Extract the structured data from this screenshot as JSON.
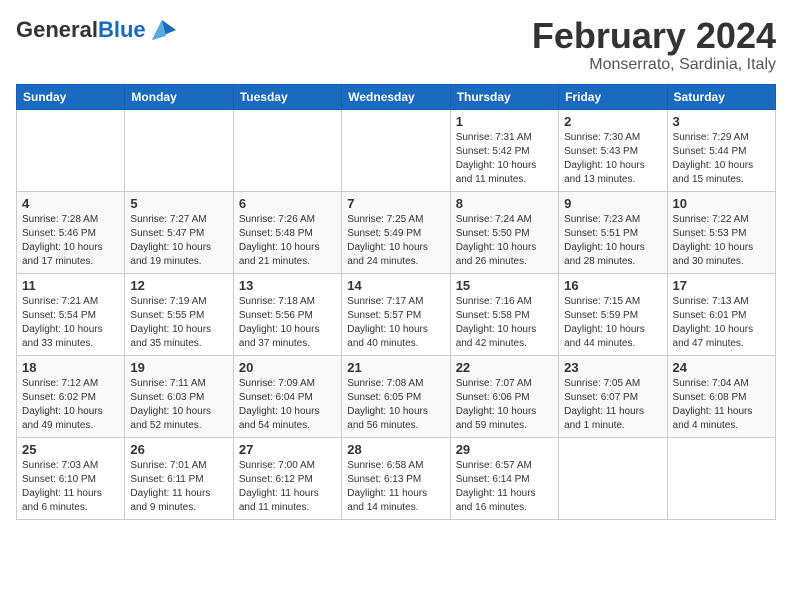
{
  "header": {
    "logo_general": "General",
    "logo_blue": "Blue",
    "month_year": "February 2024",
    "location": "Monserrato, Sardinia, Italy"
  },
  "calendar": {
    "days_of_week": [
      "Sunday",
      "Monday",
      "Tuesday",
      "Wednesday",
      "Thursday",
      "Friday",
      "Saturday"
    ],
    "weeks": [
      [
        {
          "day": "",
          "details": ""
        },
        {
          "day": "",
          "details": ""
        },
        {
          "day": "",
          "details": ""
        },
        {
          "day": "",
          "details": ""
        },
        {
          "day": "1",
          "details": "Sunrise: 7:31 AM\nSunset: 5:42 PM\nDaylight: 10 hours and 11 minutes."
        },
        {
          "day": "2",
          "details": "Sunrise: 7:30 AM\nSunset: 5:43 PM\nDaylight: 10 hours and 13 minutes."
        },
        {
          "day": "3",
          "details": "Sunrise: 7:29 AM\nSunset: 5:44 PM\nDaylight: 10 hours and 15 minutes."
        }
      ],
      [
        {
          "day": "4",
          "details": "Sunrise: 7:28 AM\nSunset: 5:46 PM\nDaylight: 10 hours and 17 minutes."
        },
        {
          "day": "5",
          "details": "Sunrise: 7:27 AM\nSunset: 5:47 PM\nDaylight: 10 hours and 19 minutes."
        },
        {
          "day": "6",
          "details": "Sunrise: 7:26 AM\nSunset: 5:48 PM\nDaylight: 10 hours and 21 minutes."
        },
        {
          "day": "7",
          "details": "Sunrise: 7:25 AM\nSunset: 5:49 PM\nDaylight: 10 hours and 24 minutes."
        },
        {
          "day": "8",
          "details": "Sunrise: 7:24 AM\nSunset: 5:50 PM\nDaylight: 10 hours and 26 minutes."
        },
        {
          "day": "9",
          "details": "Sunrise: 7:23 AM\nSunset: 5:51 PM\nDaylight: 10 hours and 28 minutes."
        },
        {
          "day": "10",
          "details": "Sunrise: 7:22 AM\nSunset: 5:53 PM\nDaylight: 10 hours and 30 minutes."
        }
      ],
      [
        {
          "day": "11",
          "details": "Sunrise: 7:21 AM\nSunset: 5:54 PM\nDaylight: 10 hours and 33 minutes."
        },
        {
          "day": "12",
          "details": "Sunrise: 7:19 AM\nSunset: 5:55 PM\nDaylight: 10 hours and 35 minutes."
        },
        {
          "day": "13",
          "details": "Sunrise: 7:18 AM\nSunset: 5:56 PM\nDaylight: 10 hours and 37 minutes."
        },
        {
          "day": "14",
          "details": "Sunrise: 7:17 AM\nSunset: 5:57 PM\nDaylight: 10 hours and 40 minutes."
        },
        {
          "day": "15",
          "details": "Sunrise: 7:16 AM\nSunset: 5:58 PM\nDaylight: 10 hours and 42 minutes."
        },
        {
          "day": "16",
          "details": "Sunrise: 7:15 AM\nSunset: 5:59 PM\nDaylight: 10 hours and 44 minutes."
        },
        {
          "day": "17",
          "details": "Sunrise: 7:13 AM\nSunset: 6:01 PM\nDaylight: 10 hours and 47 minutes."
        }
      ],
      [
        {
          "day": "18",
          "details": "Sunrise: 7:12 AM\nSunset: 6:02 PM\nDaylight: 10 hours and 49 minutes."
        },
        {
          "day": "19",
          "details": "Sunrise: 7:11 AM\nSunset: 6:03 PM\nDaylight: 10 hours and 52 minutes."
        },
        {
          "day": "20",
          "details": "Sunrise: 7:09 AM\nSunset: 6:04 PM\nDaylight: 10 hours and 54 minutes."
        },
        {
          "day": "21",
          "details": "Sunrise: 7:08 AM\nSunset: 6:05 PM\nDaylight: 10 hours and 56 minutes."
        },
        {
          "day": "22",
          "details": "Sunrise: 7:07 AM\nSunset: 6:06 PM\nDaylight: 10 hours and 59 minutes."
        },
        {
          "day": "23",
          "details": "Sunrise: 7:05 AM\nSunset: 6:07 PM\nDaylight: 11 hours and 1 minute."
        },
        {
          "day": "24",
          "details": "Sunrise: 7:04 AM\nSunset: 6:08 PM\nDaylight: 11 hours and 4 minutes."
        }
      ],
      [
        {
          "day": "25",
          "details": "Sunrise: 7:03 AM\nSunset: 6:10 PM\nDaylight: 11 hours and 6 minutes."
        },
        {
          "day": "26",
          "details": "Sunrise: 7:01 AM\nSunset: 6:11 PM\nDaylight: 11 hours and 9 minutes."
        },
        {
          "day": "27",
          "details": "Sunrise: 7:00 AM\nSunset: 6:12 PM\nDaylight: 11 hours and 11 minutes."
        },
        {
          "day": "28",
          "details": "Sunrise: 6:58 AM\nSunset: 6:13 PM\nDaylight: 11 hours and 14 minutes."
        },
        {
          "day": "29",
          "details": "Sunrise: 6:57 AM\nSunset: 6:14 PM\nDaylight: 11 hours and 16 minutes."
        },
        {
          "day": "",
          "details": ""
        },
        {
          "day": "",
          "details": ""
        }
      ]
    ]
  }
}
